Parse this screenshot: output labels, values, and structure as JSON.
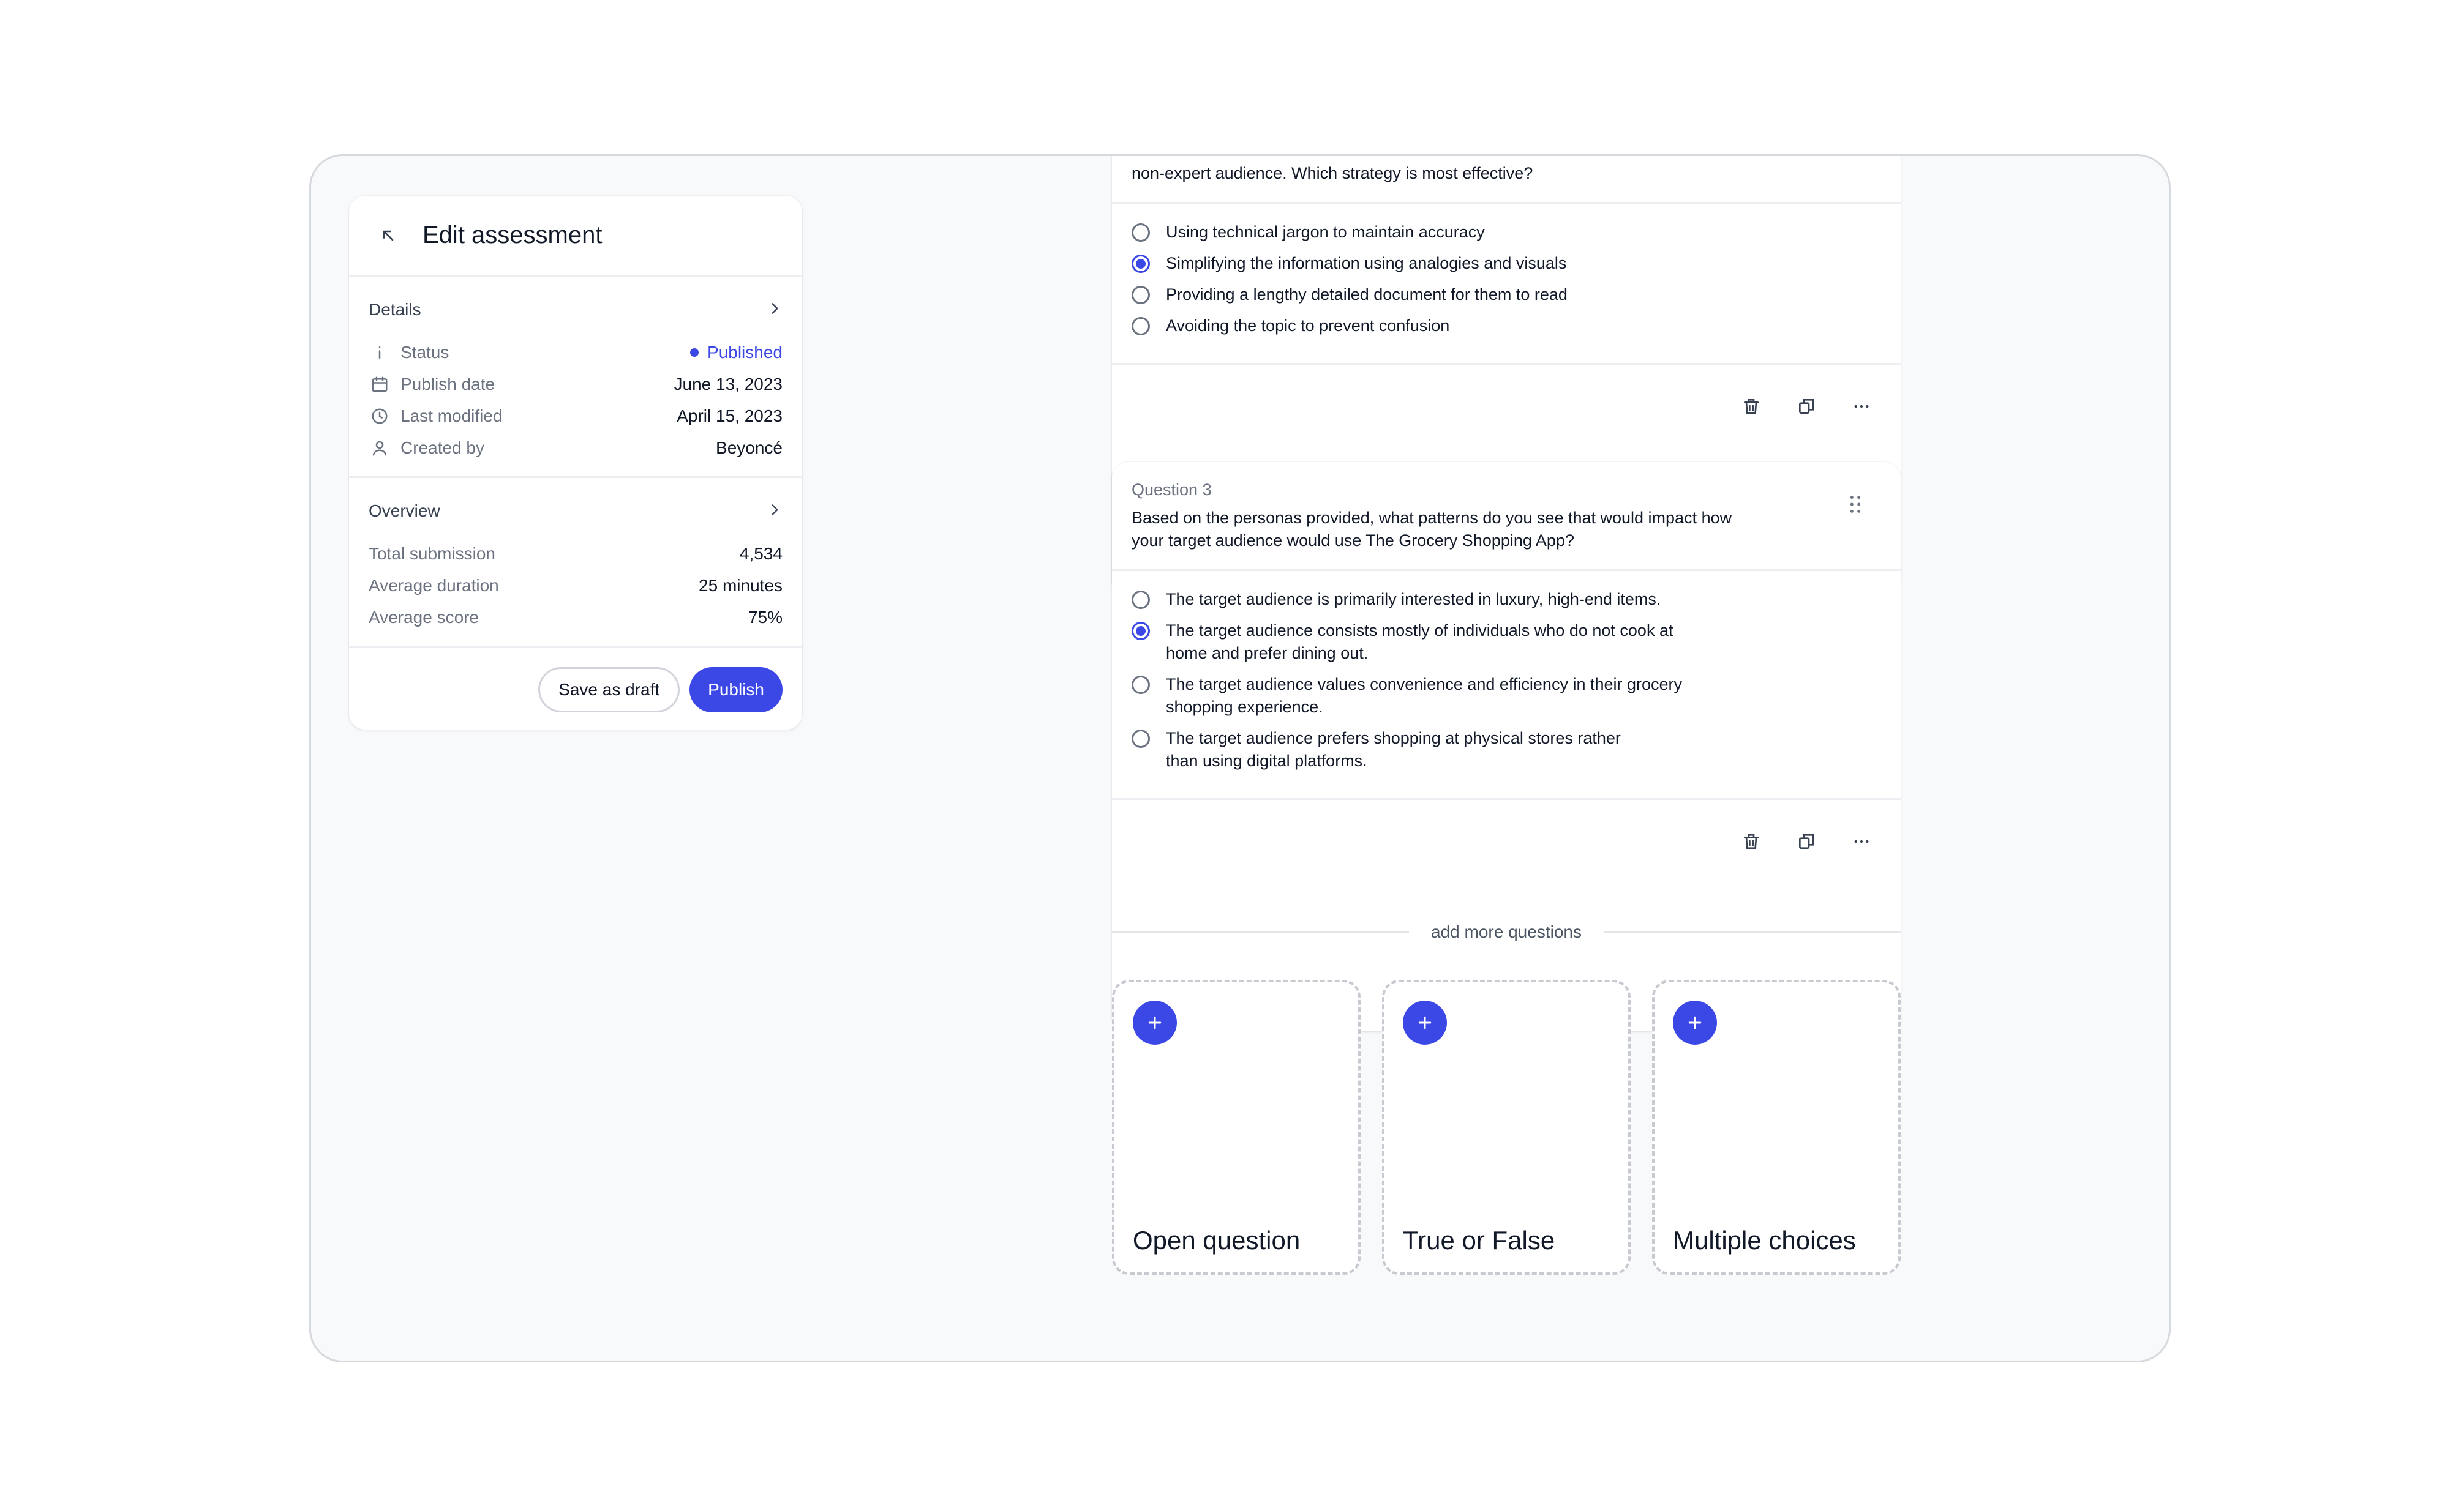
{
  "sidebar": {
    "title": "Edit assessment",
    "details": {
      "title": "Details",
      "status_label": "Status",
      "status_value": "Published",
      "publish_date_label": "Publish date",
      "publish_date_value": "June 13, 2023",
      "last_modified_label": "Last modified",
      "last_modified_value": "April 15, 2023",
      "created_by_label": "Created by",
      "created_by_value": "Beyoncé"
    },
    "overview": {
      "title": "Overview",
      "total_submission_label": "Total submission",
      "total_submission_value": "4,534",
      "average_duration_label": "Average duration",
      "average_duration_value": "25 minutes",
      "average_score_label": "Average score",
      "average_score_value": "75%"
    },
    "actions": {
      "save_draft_label": "Save as draft",
      "publish_label": "Publish"
    }
  },
  "question2": {
    "text": "non-expert audience. Which strategy is most effective?",
    "options": [
      "Using technical jargon to maintain accuracy",
      "Simplifying the information using analogies and visuals",
      "Providing a lengthy detailed document for them to read",
      "Avoiding the topic to prevent confusion"
    ],
    "selected_index": 1
  },
  "question3": {
    "number": "Question 3",
    "text": "Based on the personas provided, what patterns do you see that would impact how your target audience would use The Grocery Shopping App?",
    "options": [
      "The target audience is primarily interested in luxury, high-end items.",
      "The target audience consists mostly of individuals who do not cook at home and prefer dining out.",
      "The target audience values convenience and efficiency in their grocery shopping experience.",
      "The target audience prefers shopping at physical stores rather than using digital platforms."
    ],
    "selected_index": 1
  },
  "add_more": {
    "label": "add more questions",
    "types": [
      "Open question",
      "True or False",
      "Multiple choices"
    ]
  },
  "colors": {
    "accent": "#3b48e6",
    "frame_bg": "#f8f9fb"
  }
}
